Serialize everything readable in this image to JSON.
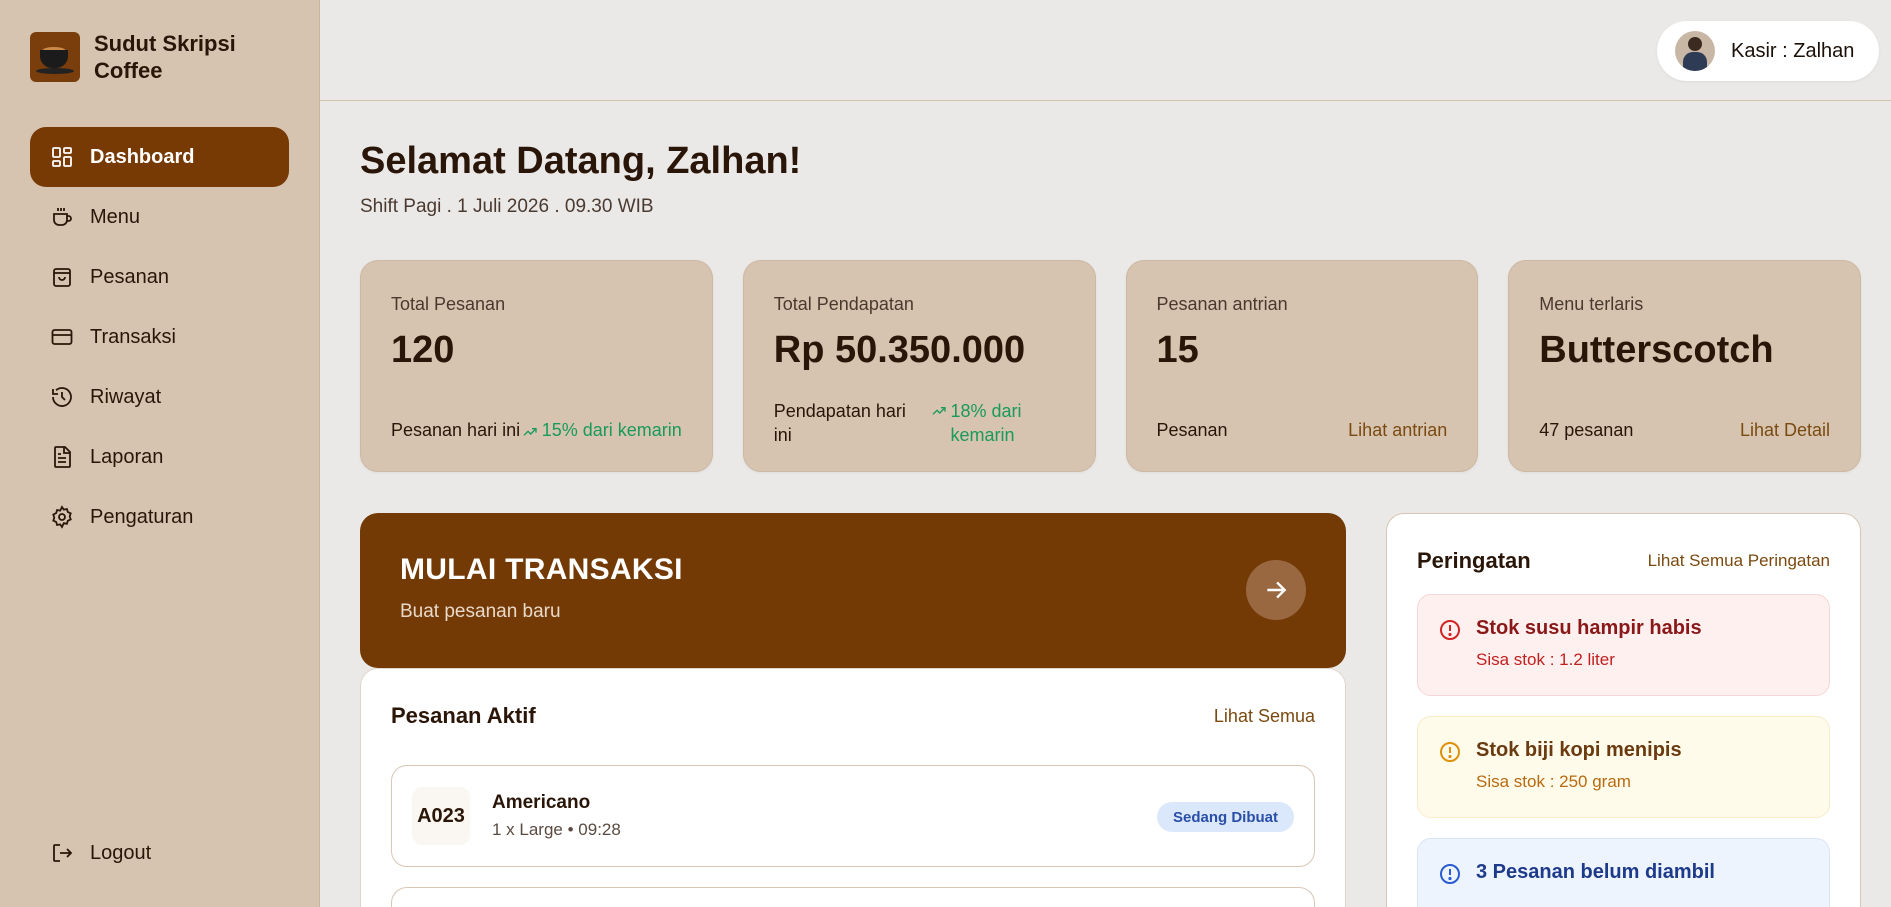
{
  "brand": {
    "name": "Sudut Skripsi Coffee",
    "logo_icon": "coffee-cup-logo"
  },
  "sidebar": {
    "items": [
      {
        "label": "Dashboard",
        "icon": "dashboard-icon",
        "active": true
      },
      {
        "label": "Menu",
        "icon": "cup-icon",
        "active": false
      },
      {
        "label": "Pesanan",
        "icon": "bag-icon",
        "active": false
      },
      {
        "label": "Transaksi",
        "icon": "card-icon",
        "active": false
      },
      {
        "label": "Riwayat",
        "icon": "history-icon",
        "active": false
      },
      {
        "label": "Laporan",
        "icon": "document-icon",
        "active": false
      },
      {
        "label": "Pengaturan",
        "icon": "gear-icon",
        "active": false
      }
    ],
    "logout_label": "Logout"
  },
  "topbar": {
    "user_label": "Kasir : Zalhan"
  },
  "main": {
    "greeting": "Selamat Datang, Zalhan!",
    "shift": "Shift Pagi . 1 Juli 2026 . 09.30 WIB"
  },
  "cards": [
    {
      "label": "Total Pesanan",
      "value": "120",
      "foot": "Pesanan hari ini",
      "trend": "15% dari kemarin"
    },
    {
      "label": "Total Pendapatan",
      "value": "Rp 50.350.000",
      "foot": "Pendapatan hari ini",
      "trend": "18% dari kemarin"
    },
    {
      "label": "Pesanan antrian",
      "value": "15",
      "foot": "Pesanan",
      "link": "Lihat antrian"
    },
    {
      "label": "Menu terlaris",
      "value": "Butterscotch",
      "foot": "47 pesanan",
      "link": "Lihat Detail"
    }
  ],
  "banner": {
    "title": "MULAI TRANSAKSI",
    "subtitle": "Buat pesanan baru"
  },
  "orders": {
    "title": "Pesanan Aktif",
    "link": "Lihat Semua",
    "rows": [
      {
        "code": "A023",
        "name": "Americano",
        "detail": "1 x Large • 09:28",
        "status": "Sedang Dibuat"
      }
    ]
  },
  "alerts": {
    "title": "Peringatan",
    "link": "Lihat Semua Peringatan",
    "items": [
      {
        "title": "Stok susu hampir habis",
        "subtitle": "Sisa stok : 1.2 liter",
        "level": "red"
      },
      {
        "title": "Stok biji kopi menipis",
        "subtitle": "Sisa stok : 250 gram",
        "level": "yellow"
      },
      {
        "title": "3 Pesanan belum diambil",
        "subtitle": "",
        "level": "blue"
      }
    ]
  },
  "colors": {
    "primary": "#773a05",
    "sidebar": "#d6c4b0",
    "background": "#ebe9e7",
    "success": "#1a9a5a"
  }
}
